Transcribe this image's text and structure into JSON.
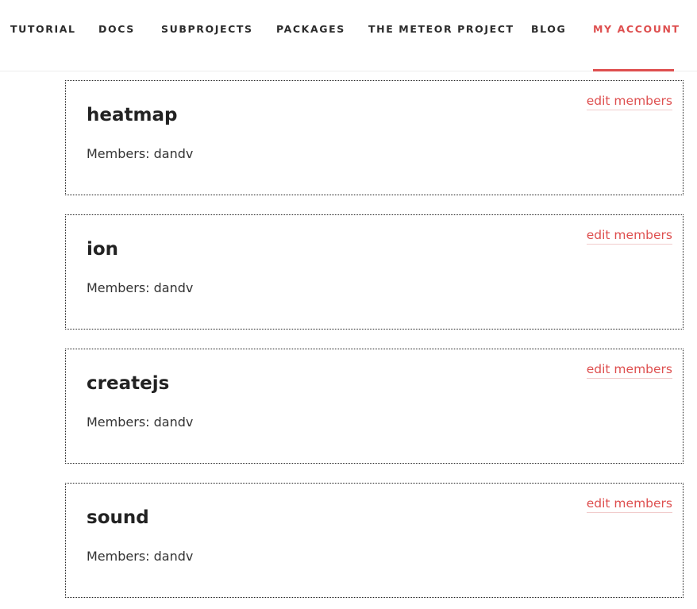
{
  "nav": {
    "items": [
      {
        "label": "TUTORIAL"
      },
      {
        "label": "DOCS"
      },
      {
        "label": "SUBPROJECTS"
      },
      {
        "label": "PACKAGES"
      },
      {
        "label": "THE METEOR PROJECT"
      },
      {
        "label": "BLOG"
      },
      {
        "label": "MY ACCOUNT",
        "active": true
      }
    ]
  },
  "colors": {
    "accent": "#de4f4f",
    "text": "#222222"
  },
  "packages": [
    {
      "name": "heatmap",
      "members_label": "Members: dandv",
      "edit_label": "edit members"
    },
    {
      "name": "ion",
      "members_label": "Members: dandv",
      "edit_label": "edit members"
    },
    {
      "name": "createjs",
      "members_label": "Members: dandv",
      "edit_label": "edit members"
    },
    {
      "name": "sound",
      "members_label": "Members: dandv",
      "edit_label": "edit members"
    }
  ]
}
